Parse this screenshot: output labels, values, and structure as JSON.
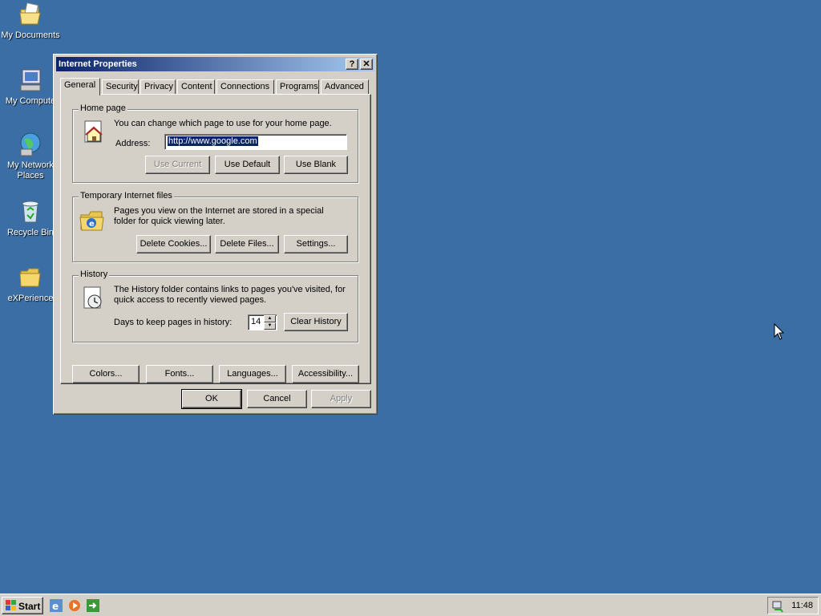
{
  "desktop": {
    "icons": [
      {
        "label": "My Documents",
        "icon": "my-documents-icon"
      },
      {
        "label": "My Compute",
        "icon": "my-computer-icon"
      },
      {
        "label": "My Network Places",
        "icon": "network-places-icon"
      },
      {
        "label": "Recycle Bin",
        "icon": "recycle-bin-icon"
      },
      {
        "label": "eXPerience",
        "icon": "folder-icon"
      }
    ]
  },
  "dialog": {
    "title": "Internet Properties",
    "help_btn": "?",
    "close_btn": "✕",
    "tabs": [
      "General",
      "Security",
      "Privacy",
      "Content",
      "Connections",
      "Programs",
      "Advanced"
    ],
    "active_tab": "General",
    "home_page": {
      "legend": "Home page",
      "description": "You can change which page to use for your home page.",
      "address_label": "Address:",
      "address_value": "http://www.google.com",
      "buttons": {
        "use_current": "Use Current",
        "use_default": "Use Default",
        "use_blank": "Use Blank"
      }
    },
    "temp_files": {
      "legend": "Temporary Internet files",
      "description": "Pages you view on the Internet are stored in a special folder for quick viewing later.",
      "buttons": {
        "delete_cookies": "Delete Cookies...",
        "delete_files": "Delete Files...",
        "settings": "Settings..."
      }
    },
    "history": {
      "legend": "History",
      "description": "The History folder contains links to pages you've visited, for quick access to recently viewed pages.",
      "days_label": "Days to keep pages in history:",
      "days_value": "14",
      "clear_button": "Clear History"
    },
    "bottom_buttons": {
      "colors": "Colors...",
      "fonts": "Fonts...",
      "languages": "Languages...",
      "accessibility": "Accessibility..."
    },
    "footer": {
      "ok": "OK",
      "cancel": "Cancel",
      "apply": "Apply"
    }
  },
  "taskbar": {
    "start_label": "Start",
    "clock": "11:48"
  },
  "colors": {
    "desktop": "#3a6ea5",
    "face": "#d4d0c8",
    "title_start": "#0a246a",
    "title_end": "#a6caf0"
  }
}
